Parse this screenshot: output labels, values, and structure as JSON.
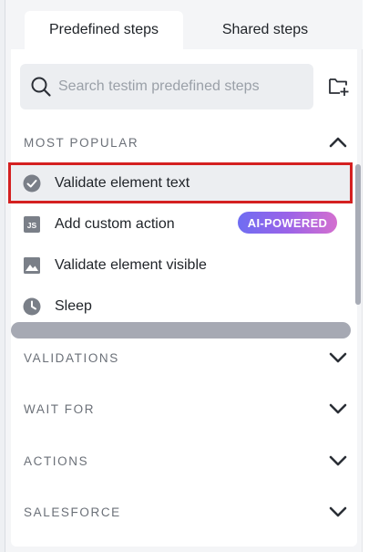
{
  "tabs": {
    "predefined": "Predefined steps",
    "shared": "Shared steps"
  },
  "search": {
    "placeholder": "Search testim predefined steps",
    "value": ""
  },
  "sections": {
    "popular": "MOST POPULAR",
    "validations": "VALIDATIONS",
    "wait_for": "WAIT FOR",
    "actions": "ACTIONS",
    "salesforce": "SALESFORCE"
  },
  "popular_items": [
    {
      "label": "Validate element text",
      "icon": "check-circle-icon"
    },
    {
      "label": "Add custom action",
      "icon": "js-icon",
      "badge": "AI-POWERED"
    },
    {
      "label": "Validate element visible",
      "icon": "image-icon"
    },
    {
      "label": "Sleep",
      "icon": "clock-icon"
    }
  ],
  "colors": {
    "highlight_border": "#d42020",
    "badge_gradient_start": "#6f6df2",
    "badge_gradient_end": "#d46fcf",
    "icon_gray": "#7a7f88"
  }
}
